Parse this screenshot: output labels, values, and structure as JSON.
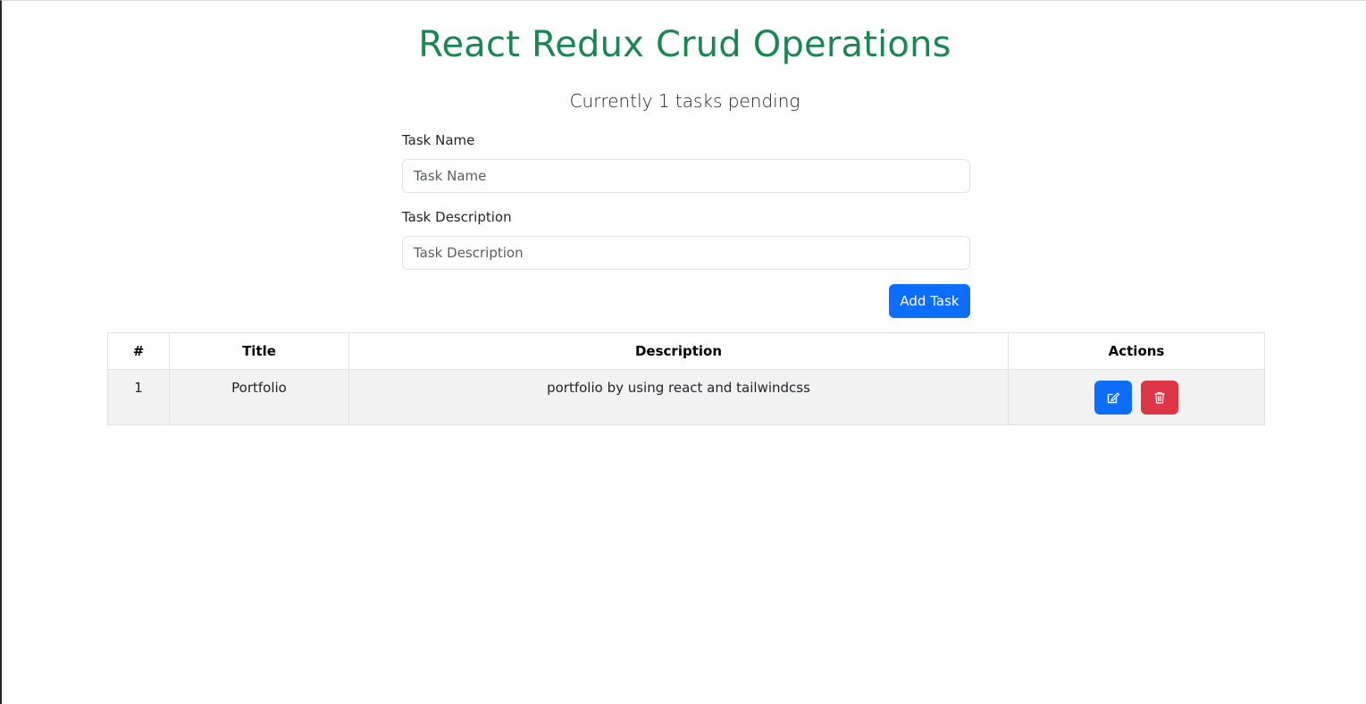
{
  "header": {
    "title": "React Redux Crud Operations",
    "pending_text": "Currently 1 tasks pending"
  },
  "form": {
    "name_label": "Task Name",
    "name_placeholder": "Task Name",
    "name_value": "",
    "description_label": "Task Description",
    "description_placeholder": "Task Description",
    "description_value": "",
    "add_button_label": "Add Task"
  },
  "table": {
    "columns": [
      "#",
      "Title",
      "Description",
      "Actions"
    ],
    "rows": [
      {
        "index": "1",
        "title": "Portfolio",
        "description": "portfolio by using react and tailwindcss",
        "actions": [
          "edit-icon",
          "trash-icon"
        ]
      }
    ]
  },
  "colors": {
    "title": "#198754",
    "primary": "#0d6efd",
    "danger": "#dc3545",
    "row_background": "#f2f2f2"
  }
}
